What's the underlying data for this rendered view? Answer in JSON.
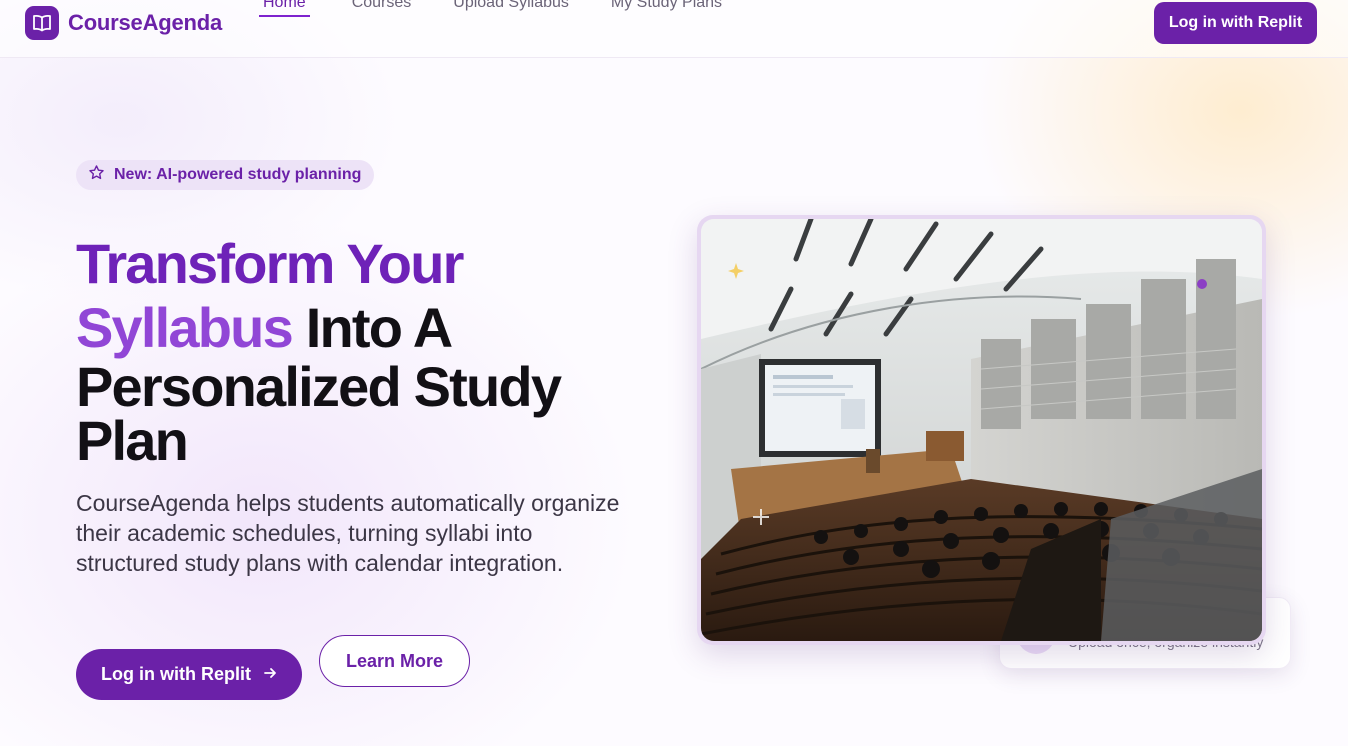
{
  "brand": {
    "name": "CourseAgenda",
    "icon": "open-book-icon"
  },
  "nav": {
    "links": [
      {
        "label": "Home",
        "active": true
      },
      {
        "label": "Courses",
        "active": false
      },
      {
        "label": "Upload Syllabus",
        "active": false
      },
      {
        "label": "My Study Plans",
        "active": false
      }
    ],
    "login_label": "Log in with Replit"
  },
  "hero": {
    "badge": {
      "icon": "star-icon",
      "text": "New: AI-powered study planning"
    },
    "headline": {
      "line1": "Transform Your",
      "line2_accent": "Syllabus",
      "line2_rest": "Into A",
      "line3": "Personalized Study",
      "line4": "Plan"
    },
    "description": "CourseAgenda helps students automatically organize their academic schedules, turning syllabi into structured study plans with calendar integration.",
    "primary_cta": {
      "label": "Log in with Replit",
      "icon": "arrow-right-icon"
    },
    "secondary_cta": {
      "label": "Learn More"
    }
  },
  "feature_card": {
    "text": "Upload once, organize instantly"
  },
  "colors": {
    "brand": "#6b21a8",
    "accent": "#9146d6",
    "badge_bg": "#ede3f7"
  }
}
